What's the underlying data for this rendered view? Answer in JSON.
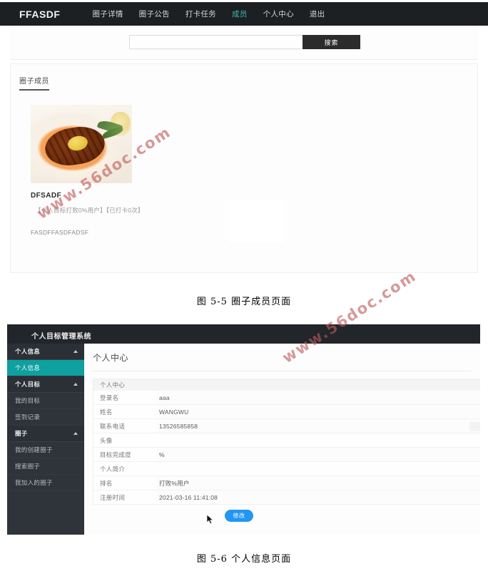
{
  "figure1": {
    "navbar": {
      "brand": "FFASDF",
      "links": [
        {
          "label": "圈子详情",
          "active": false
        },
        {
          "label": "圈子公告",
          "active": false
        },
        {
          "label": "打卡任务",
          "active": false
        },
        {
          "label": "成员",
          "active": true
        },
        {
          "label": "个人中心",
          "active": false
        },
        {
          "label": "退出",
          "active": false
        }
      ],
      "active_color": "#3fb6b6",
      "background": "#1d2023"
    },
    "search": {
      "value": "",
      "placeholder": "",
      "button_label": "搜索"
    },
    "tab": {
      "label": "圈子成员"
    },
    "member": {
      "name": "DFSADF",
      "stats": "【个人目标打败0%用户】【已打卡0次】",
      "description": "FASDFFASDFADSF",
      "photo_icon": "food-photo"
    }
  },
  "caption1": "图 5-5 圈子成员页面",
  "figure2": {
    "topbar": {
      "title": "个人目标管理系统",
      "background": "#22252a"
    },
    "sidebar": {
      "groups": [
        {
          "label": "个人信息",
          "icon": "chevron-up-icon",
          "items": [
            {
              "label": "个人信息",
              "active": true
            }
          ]
        },
        {
          "label": "个人目标",
          "icon": "chevron-up-icon",
          "items": [
            {
              "label": "我的目标",
              "active": false
            },
            {
              "label": "签到记录",
              "active": false
            }
          ]
        },
        {
          "label": "圈子",
          "icon": "chevron-up-icon",
          "items": [
            {
              "label": "我的创建圈子",
              "active": false
            },
            {
              "label": "搜索圈子",
              "active": false
            },
            {
              "label": "我加入的圈子",
              "active": false
            }
          ]
        }
      ],
      "active_color": "#0fa0a0",
      "background": "#2f333a"
    },
    "page_title": "个人中心",
    "panel": {
      "header": "个人中心",
      "rows": [
        {
          "label": "登录名",
          "value": "aaa"
        },
        {
          "label": "姓名",
          "value": "WANGWU"
        },
        {
          "label": "联系电话",
          "value": "13526585858"
        },
        {
          "label": "头像",
          "value": ""
        },
        {
          "label": "目标完成度",
          "value": "%"
        },
        {
          "label": "个人简介",
          "value": ""
        },
        {
          "label": "排名",
          "value": "打败%用户"
        },
        {
          "label": "注册时间",
          "value": "2021-03-16 11:41:08"
        }
      ]
    },
    "edit_button": {
      "label": "修改",
      "color": "#2196f3"
    },
    "cursor": "mouse-pointer"
  },
  "caption2": "图 5-6 个人信息页面",
  "watermarks": {
    "text1": "www.56doc.com",
    "text2": "www.56doc.com",
    "color": "#be5a5a"
  }
}
